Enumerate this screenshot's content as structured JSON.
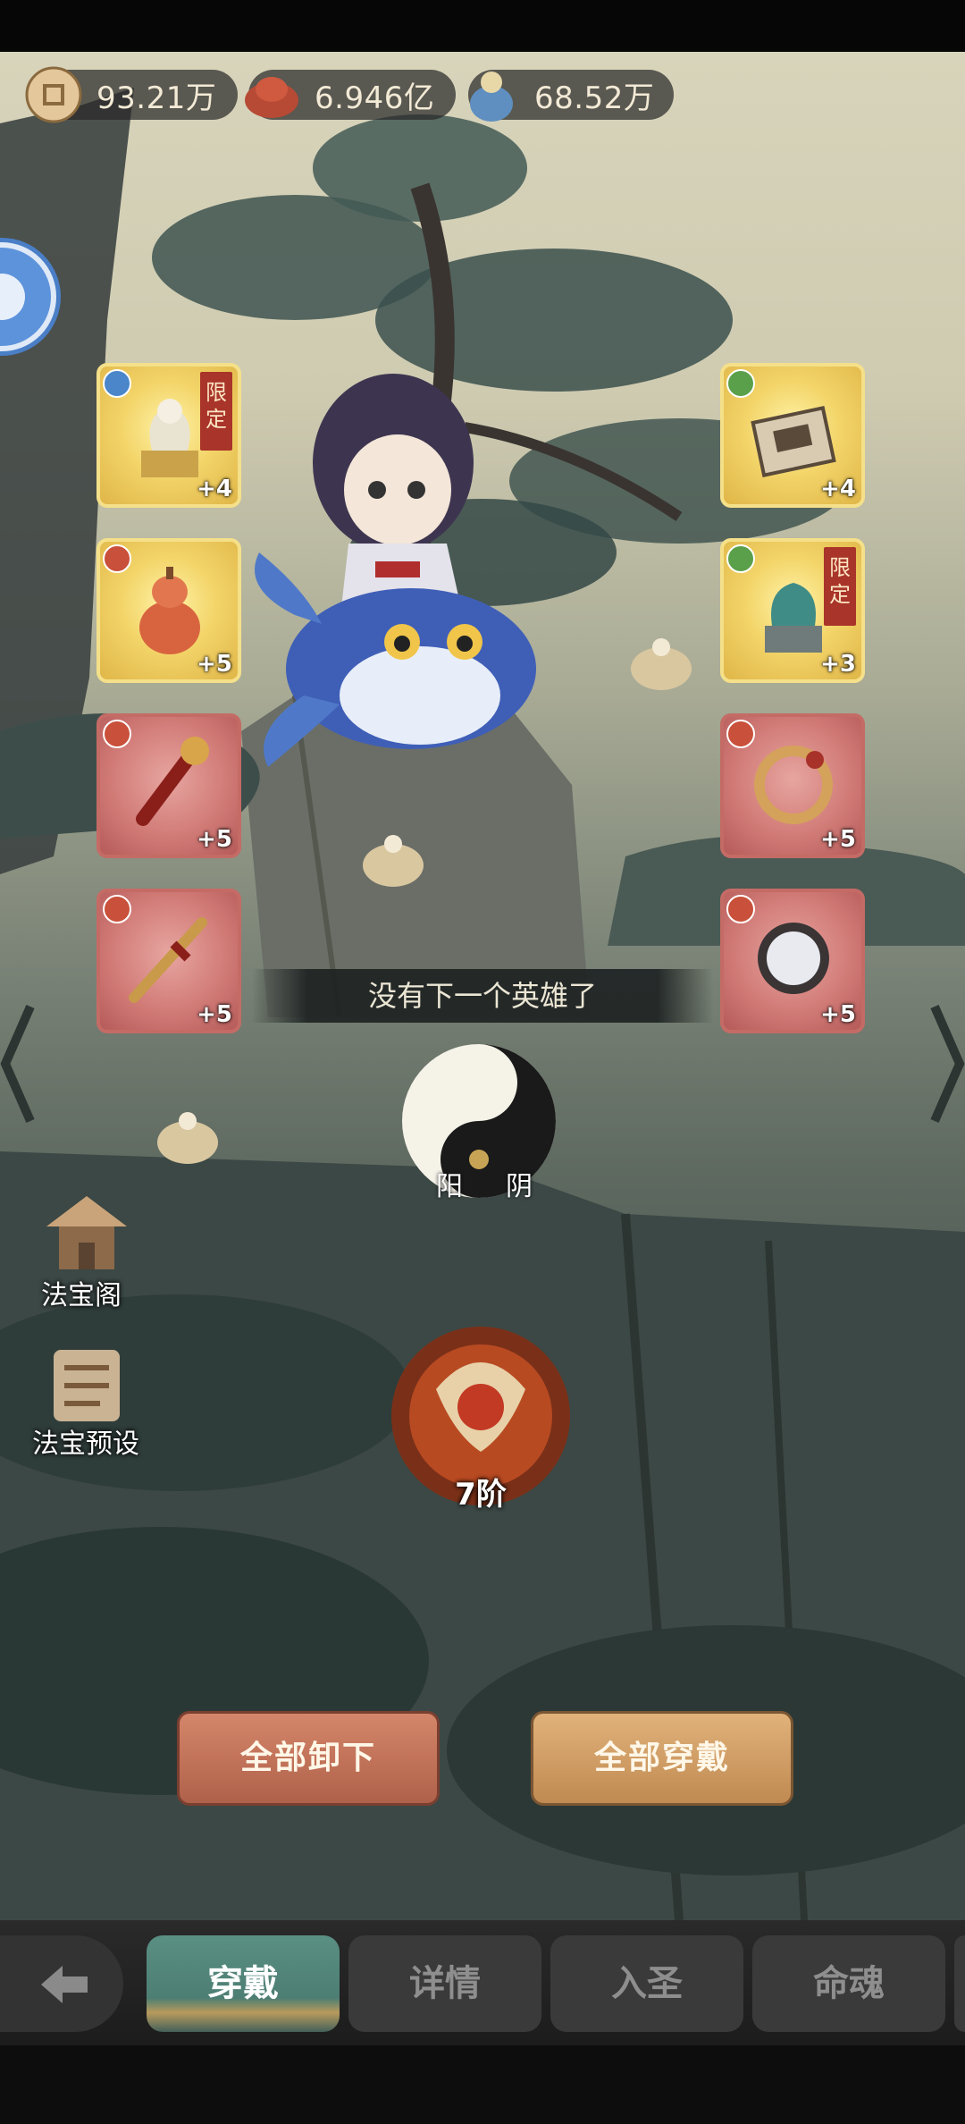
{
  "currency": [
    {
      "icon": "coin-icon",
      "value": "93.21万"
    },
    {
      "icon": "gourd-icon",
      "value": "6.946亿"
    },
    {
      "icon": "spirit-icon",
      "value": "68.52万"
    }
  ],
  "slots_left": [
    {
      "icon": "dragon-statue-icon",
      "level": "+4",
      "tag": "限定"
    },
    {
      "icon": "gourd-treasure-icon",
      "level": "+5"
    },
    {
      "icon": "ruyi-scepter-icon",
      "level": "+5"
    },
    {
      "icon": "sword-icon",
      "level": "+5"
    }
  ],
  "slots_right": [
    {
      "icon": "scroll-book-icon",
      "level": "+4"
    },
    {
      "icon": "qilin-statue-icon",
      "level": "+3",
      "tag": "限定"
    },
    {
      "icon": "dragon-ring-icon",
      "level": "+5"
    },
    {
      "icon": "mirror-icon",
      "level": "+5"
    }
  ],
  "banner": "没有下一个英雄了",
  "yinyang": {
    "yang": "阳",
    "yin": "阴"
  },
  "side_buttons": {
    "pavilion": "法宝阁",
    "preset": "法宝预设"
  },
  "rank": "7阶",
  "buttons": {
    "unequip_all": "全部卸下",
    "equip_all": "全部穿戴"
  },
  "tabs": [
    "穿戴",
    "详情",
    "入圣",
    "命魂"
  ],
  "active_tab": "穿戴",
  "colors": {
    "gold_slot": "#f3d56a",
    "red_slot": "#d27c78",
    "tab_active": "#5a8f84"
  }
}
